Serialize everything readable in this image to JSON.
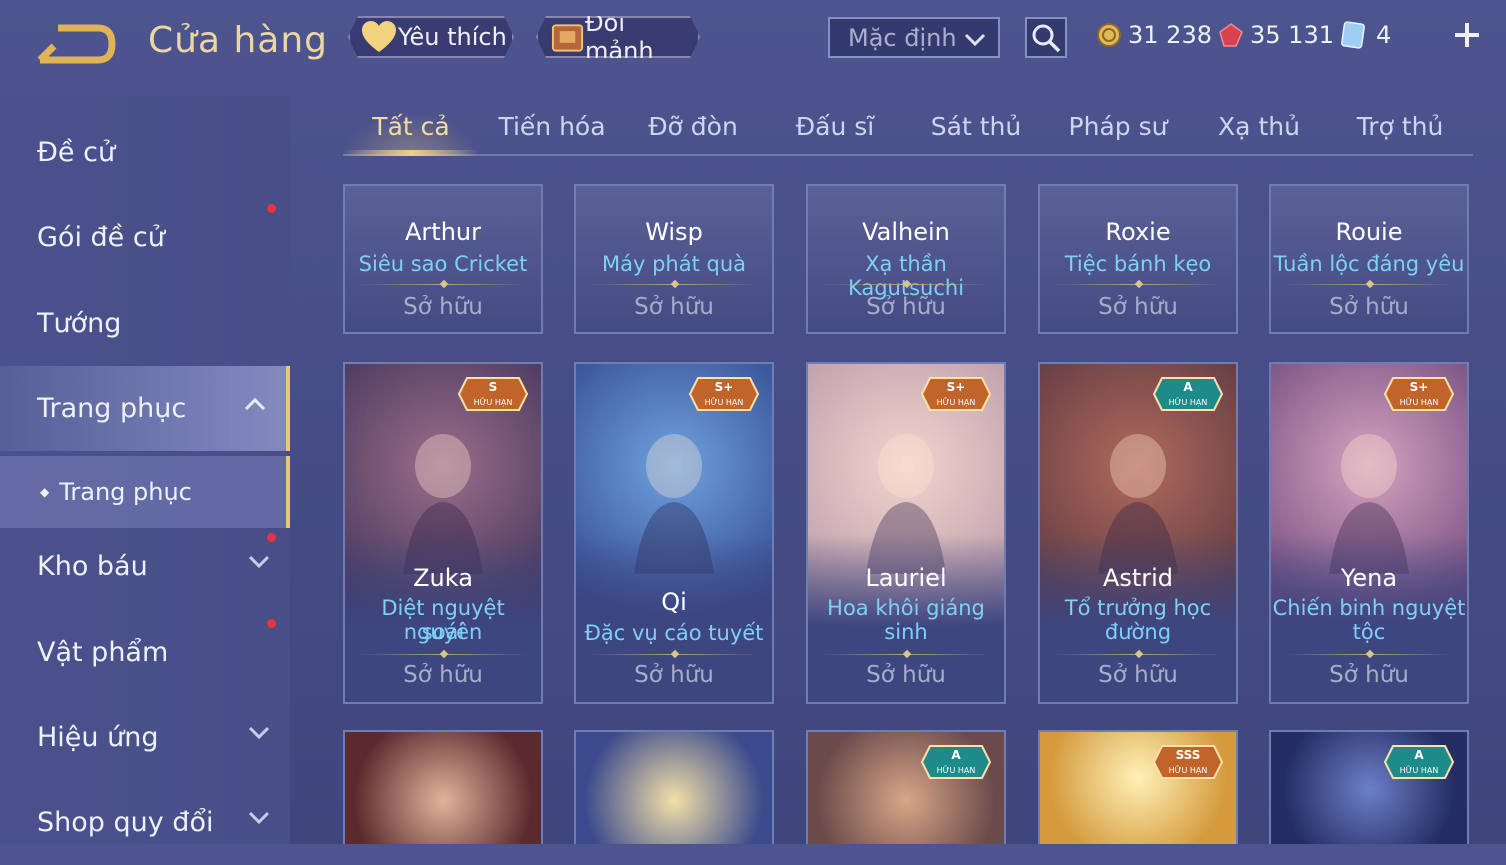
{
  "header": {
    "title": "Cửa hàng",
    "favorite_label": "Yêu thích",
    "exchange_label": "Đổi mảnh",
    "sort_value": "Mặc định",
    "currencies": [
      {
        "icon": "gold-coin-icon",
        "value": "31 238"
      },
      {
        "icon": "red-gem-icon",
        "value": "35 131"
      },
      {
        "icon": "blue-voucher-icon",
        "value": "4"
      }
    ]
  },
  "sidebar": {
    "items": [
      {
        "label": "Đề cử"
      },
      {
        "label": "Gói đề cử"
      },
      {
        "label": "Tướng"
      },
      {
        "label": "Trang phục"
      },
      {
        "label": "Trang phục"
      },
      {
        "label": "Kho báu"
      },
      {
        "label": "Vật phẩm"
      },
      {
        "label": "Hiệu ứng"
      },
      {
        "label": "Shop quy đổi"
      }
    ]
  },
  "tabs": [
    "Tất cả",
    "Tiến hóa",
    "Đỡ đòn",
    "Đấu sĩ",
    "Sát thủ",
    "Pháp sư",
    "Xạ thủ",
    "Trợ thủ"
  ],
  "cards_row1": [
    {
      "hero": "Arthur",
      "skin": "Siêu sao Cricket",
      "status": "Sở hữu"
    },
    {
      "hero": "Wisp",
      "skin": "Máy phát quà",
      "status": "Sở hữu"
    },
    {
      "hero": "Valhein",
      "skin": "Xạ thần Kagutsuchi",
      "status": "Sở hữu"
    },
    {
      "hero": "Roxie",
      "skin": "Tiệc bánh kẹo",
      "status": "Sở hữu"
    },
    {
      "hero": "Rouie",
      "skin": "Tuần lộc đáng yêu",
      "status": "Sở hữu"
    }
  ],
  "cards_row2": [
    {
      "hero": "Zuka",
      "skin_line1": "Diệt nguyệt nguyên",
      "skin_line2": "soái",
      "status": "Sở hữu",
      "tier": "S",
      "tier_sub": "HỮU HẠN"
    },
    {
      "hero": "Qi",
      "skin_line1": "Đặc vụ cáo tuyết",
      "skin_line2": "",
      "status": "Sở hữu",
      "tier": "S+",
      "tier_sub": "HỮU HẠN"
    },
    {
      "hero": "Lauriel",
      "skin_line1": "Hoa khôi giáng",
      "skin_line2": "sinh",
      "status": "Sở hữu",
      "tier": "S+",
      "tier_sub": "HỮU HẠN"
    },
    {
      "hero": "Astrid",
      "skin_line1": "Tổ trưởng học",
      "skin_line2": "đường",
      "status": "Sở hữu",
      "tier": "A",
      "tier_sub": "HỮU HẠN"
    },
    {
      "hero": "Yena",
      "skin_line1": "Chiến binh nguyệt",
      "skin_line2": "tộc",
      "status": "Sở hữu",
      "tier": "S+",
      "tier_sub": "HỮU HẠN"
    }
  ],
  "cards_row3": [
    {
      "tier": "",
      "tier_sub": ""
    },
    {
      "tier": "",
      "tier_sub": ""
    },
    {
      "tier": "A",
      "tier_sub": "HỮU HẠN"
    },
    {
      "tier": "SSS",
      "tier_sub": "HỮU HẠN"
    },
    {
      "tier": "A",
      "tier_sub": "HỮU HẠN"
    }
  ],
  "colors": {
    "accent_gold": "#ecd7a0",
    "skin_blue": "#7ed0f5",
    "notify_red": "#e8323c"
  }
}
